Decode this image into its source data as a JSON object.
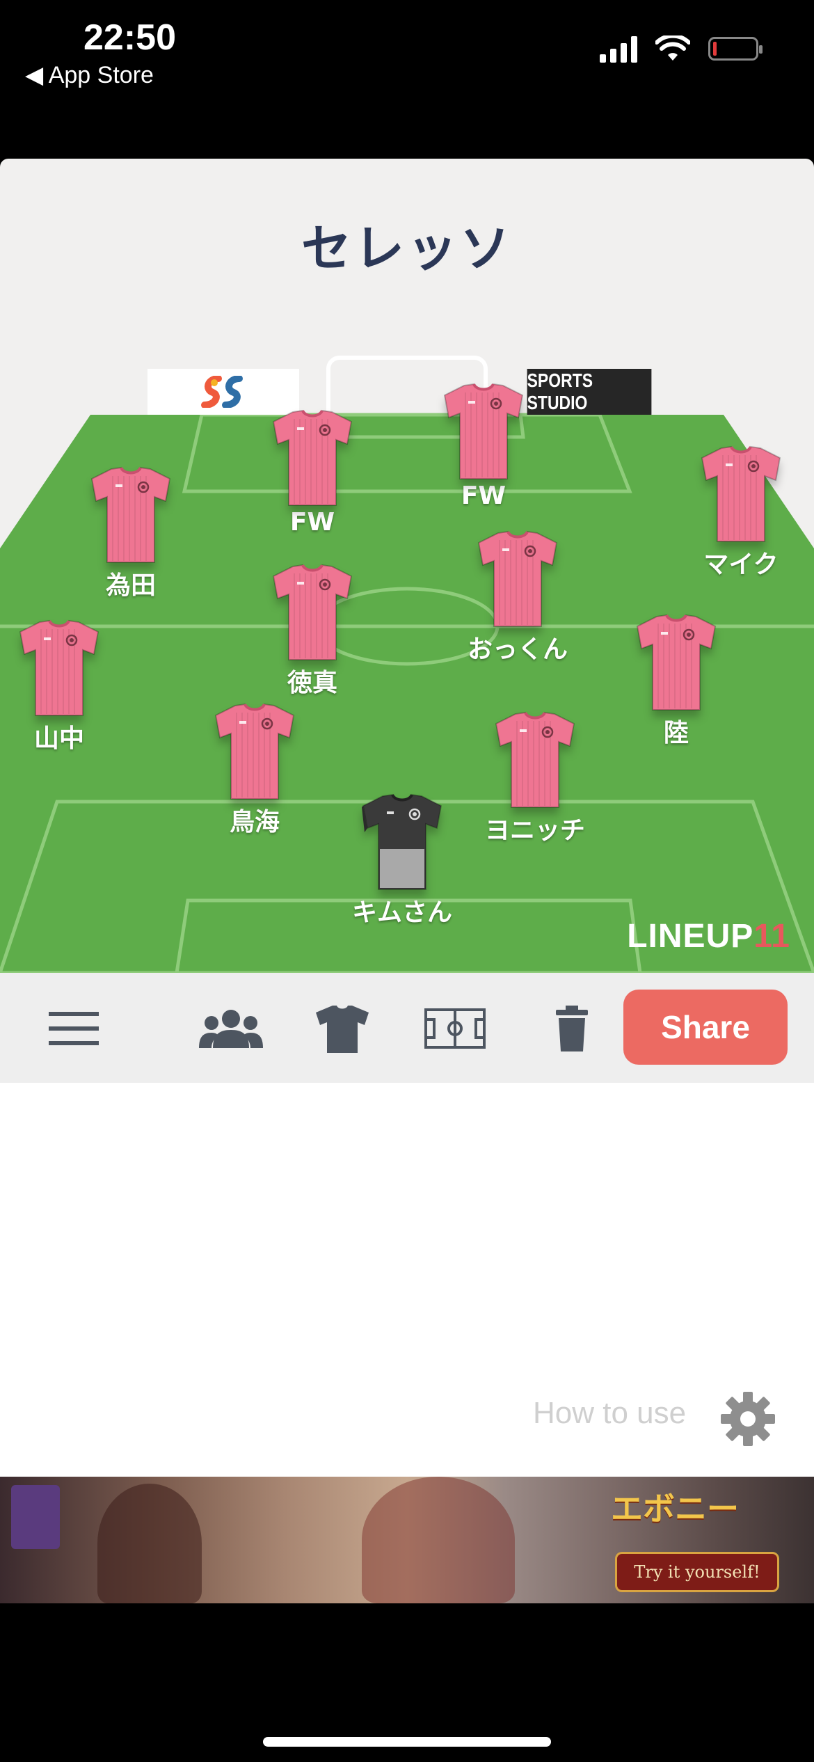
{
  "status_bar": {
    "time": "22:50",
    "back_label": "◀ App Store",
    "battery_color": "#e23b3b"
  },
  "team": {
    "name": "セレッソ"
  },
  "sponsors": {
    "right": "SPORTS STUDIO"
  },
  "jersey_colors": {
    "outfield": "#ef7592",
    "goalkeeper": "#3a3a3a"
  },
  "players": [
    {
      "id": "fw-left",
      "name": "FW"
    },
    {
      "id": "fw-right",
      "name": "FW"
    },
    {
      "id": "tameda",
      "name": "為田"
    },
    {
      "id": "mike",
      "name": "マイク"
    },
    {
      "id": "tokuma",
      "name": "徳真"
    },
    {
      "id": "okkun",
      "name": "おっくん"
    },
    {
      "id": "yamanaka",
      "name": "山中"
    },
    {
      "id": "riku",
      "name": "陸"
    },
    {
      "id": "chokai",
      "name": "鳥海"
    },
    {
      "id": "yonicchi",
      "name": "ヨニッチ"
    },
    {
      "id": "kim",
      "name": "キムさん"
    }
  ],
  "brand": {
    "text": "LINEUP",
    "accent": "11"
  },
  "toolbar": {
    "icons": [
      "menu-icon",
      "players-icon",
      "jersey-icon",
      "pitch-icon",
      "trash-icon"
    ],
    "share_label": "Share",
    "share_color": "#ec6a62"
  },
  "help": {
    "label": "How to use"
  },
  "ad": {
    "logo": "エボニー",
    "cta": "Try it yourself!"
  }
}
